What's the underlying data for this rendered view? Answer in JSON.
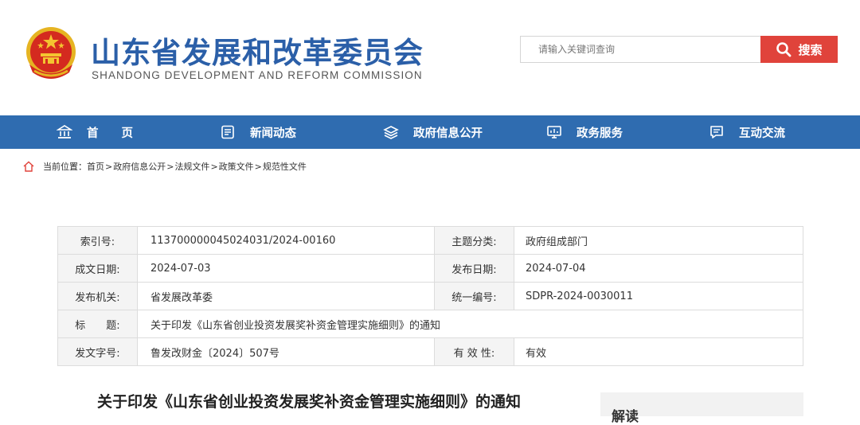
{
  "header": {
    "title": "山东省发展和改革委员会",
    "subtitle": "SHANDONG DEVELOPMENT AND REFORM COMMISSION",
    "search_placeholder": "请输入关键词查询",
    "search_button": "搜索"
  },
  "nav": {
    "items": [
      {
        "label": "首　　页",
        "icon": "home-icon"
      },
      {
        "label": "新闻动态",
        "icon": "news-icon"
      },
      {
        "label": "政府信息公开",
        "icon": "layers-icon"
      },
      {
        "label": "政务服务",
        "icon": "monitor-icon"
      },
      {
        "label": "互动交流",
        "icon": "chat-icon"
      }
    ]
  },
  "breadcrumb": {
    "prefix": "当前位置：",
    "items": [
      "首页",
      "政府信息公开",
      "法规文件",
      "政策文件",
      "规范性文件"
    ],
    "separator": ">"
  },
  "info": {
    "rows": [
      {
        "l1": "索引号:",
        "v1": "113700000045024031/2024-00160",
        "l2": "主题分类:",
        "v2": "政府组成部门"
      },
      {
        "l1": "成文日期:",
        "v1": "2024-07-03",
        "l2": "发布日期:",
        "v2": "2024-07-04"
      },
      {
        "l1": "发布机关:",
        "v1": "省发展改革委",
        "l2": "统一编号:",
        "v2": "SDPR-2024-0030011"
      },
      {
        "l1": "标　　题:",
        "v1": "关于印发《山东省创业投资发展奖补资金管理实施细则》的通知"
      },
      {
        "l1": "发文字号:",
        "v1": "鲁发改财金〔2024〕507号",
        "l2": "有 效 性:",
        "v2": "有效"
      }
    ]
  },
  "doc": {
    "title": "关于印发《山东省创业投资发展奖补资金管理实施细则》的通知"
  },
  "side": {
    "title": "解读"
  },
  "colors": {
    "brand_blue": "#2f6cb0",
    "title_blue": "#2b5fa8",
    "search_red": "#e0433b",
    "valid_red": "#d9322b"
  }
}
